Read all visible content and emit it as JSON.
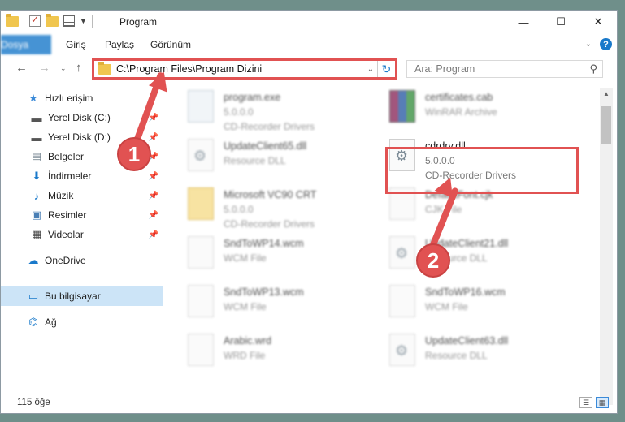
{
  "window": {
    "title": "Program"
  },
  "ribbon": {
    "tabs": [
      "Dosya",
      "Giriş",
      "Paylaş",
      "Görünüm"
    ]
  },
  "address": {
    "path": "C:\\Program Files\\Program Dizini"
  },
  "search": {
    "placeholder": "Ara: Program"
  },
  "sidebar": {
    "items": [
      {
        "label": "Hızlı erişim",
        "icon": "star-icon"
      },
      {
        "label": "Yerel Disk (C:)",
        "icon": "drive-icon",
        "pinned": true
      },
      {
        "label": "Yerel Disk (D:)",
        "icon": "drive-icon",
        "pinned": true
      },
      {
        "label": "Belgeler",
        "icon": "documents-icon",
        "pinned": true
      },
      {
        "label": "İndirmeler",
        "icon": "download-icon",
        "pinned": true
      },
      {
        "label": "Müzik",
        "icon": "music-icon",
        "pinned": true
      },
      {
        "label": "Resimler",
        "icon": "pictures-icon",
        "pinned": true
      },
      {
        "label": "Videolar",
        "icon": "video-icon",
        "pinned": true
      },
      {
        "label": "OneDrive",
        "icon": "cloud-icon"
      },
      {
        "label": "Bu bilgisayar",
        "icon": "computer-icon",
        "selected": true
      },
      {
        "label": "Ağ",
        "icon": "network-icon"
      }
    ]
  },
  "files": [
    {
      "name": "program.exe",
      "line2": "5.0.0.0",
      "line3": "CD-Recorder Drivers",
      "icon": "exe-icon"
    },
    {
      "name": "certificates.cab",
      "line2": "WinRAR Archive",
      "line3": "",
      "icon": "archive-icon"
    },
    {
      "name": "UpdateClient65.dll",
      "line2": "Resource DLL",
      "line3": "",
      "icon": "dll-icon"
    },
    {
      "name": "cdrdrv.dll",
      "line2": "5.0.0.0",
      "line3": "CD-Recorder Drivers",
      "icon": "dll-icon"
    },
    {
      "name": "Microsoft VC90 CRT",
      "line2": "5.0.0.0",
      "line3": "CD-Recorder Drivers",
      "icon": "folder-icon"
    },
    {
      "name": "DefaultFont.cjk",
      "line2": "CJK File",
      "line3": "",
      "icon": "file-icon"
    },
    {
      "name": "SndToWP14.wcm",
      "line2": "WCM File",
      "line3": "",
      "icon": "file-icon"
    },
    {
      "name": "UpdateClient21.dll",
      "line2": "Resource DLL",
      "line3": "",
      "icon": "dll-icon"
    },
    {
      "name": "SndToWP13.wcm",
      "line2": "WCM File",
      "line3": "",
      "icon": "file-icon"
    },
    {
      "name": "SndToWP16.wcm",
      "line2": "WCM File",
      "line3": "",
      "icon": "file-icon"
    },
    {
      "name": "Arabic.wrd",
      "line2": "WRD File",
      "line3": "",
      "icon": "file-icon"
    },
    {
      "name": "UpdateClient63.dll",
      "line2": "Resource DLL",
      "line3": "",
      "icon": "dll-icon"
    }
  ],
  "status": {
    "count": "115 öğe"
  },
  "callouts": {
    "one": "1",
    "two": "2"
  },
  "colors": {
    "accent": "#1979ca",
    "highlight": "#e15252"
  }
}
